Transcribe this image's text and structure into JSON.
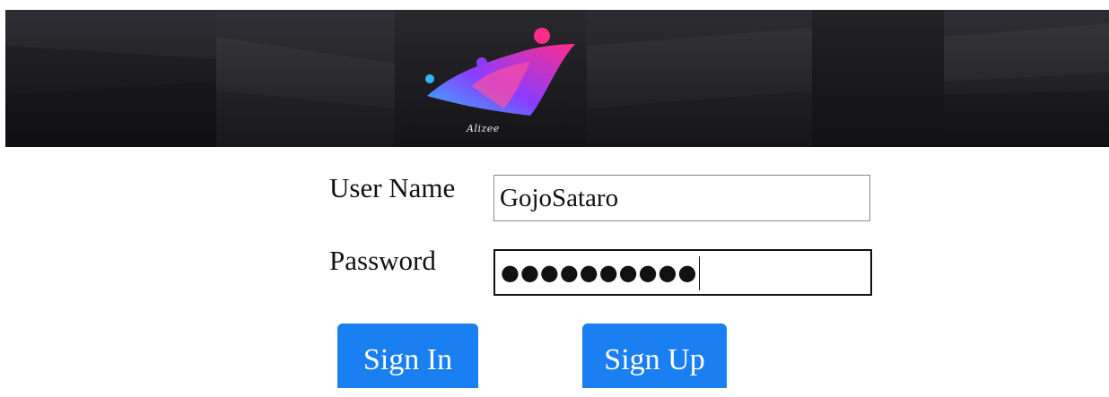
{
  "banner": {
    "logo_text": "Alizee",
    "colors": {
      "background": "#26262b",
      "logo_pink": "#ff2d8a",
      "logo_purple": "#8b3cff",
      "logo_blue": "#2fb8ff"
    }
  },
  "login_form": {
    "username_label": "User Name",
    "username_value": "GojoSataro",
    "password_label": "Password",
    "password_mask": "●●●●●●●●●●"
  },
  "actions": {
    "sign_in_label": "Sign In",
    "sign_up_label": "Sign Up",
    "button_color": "#1a7ff0"
  }
}
